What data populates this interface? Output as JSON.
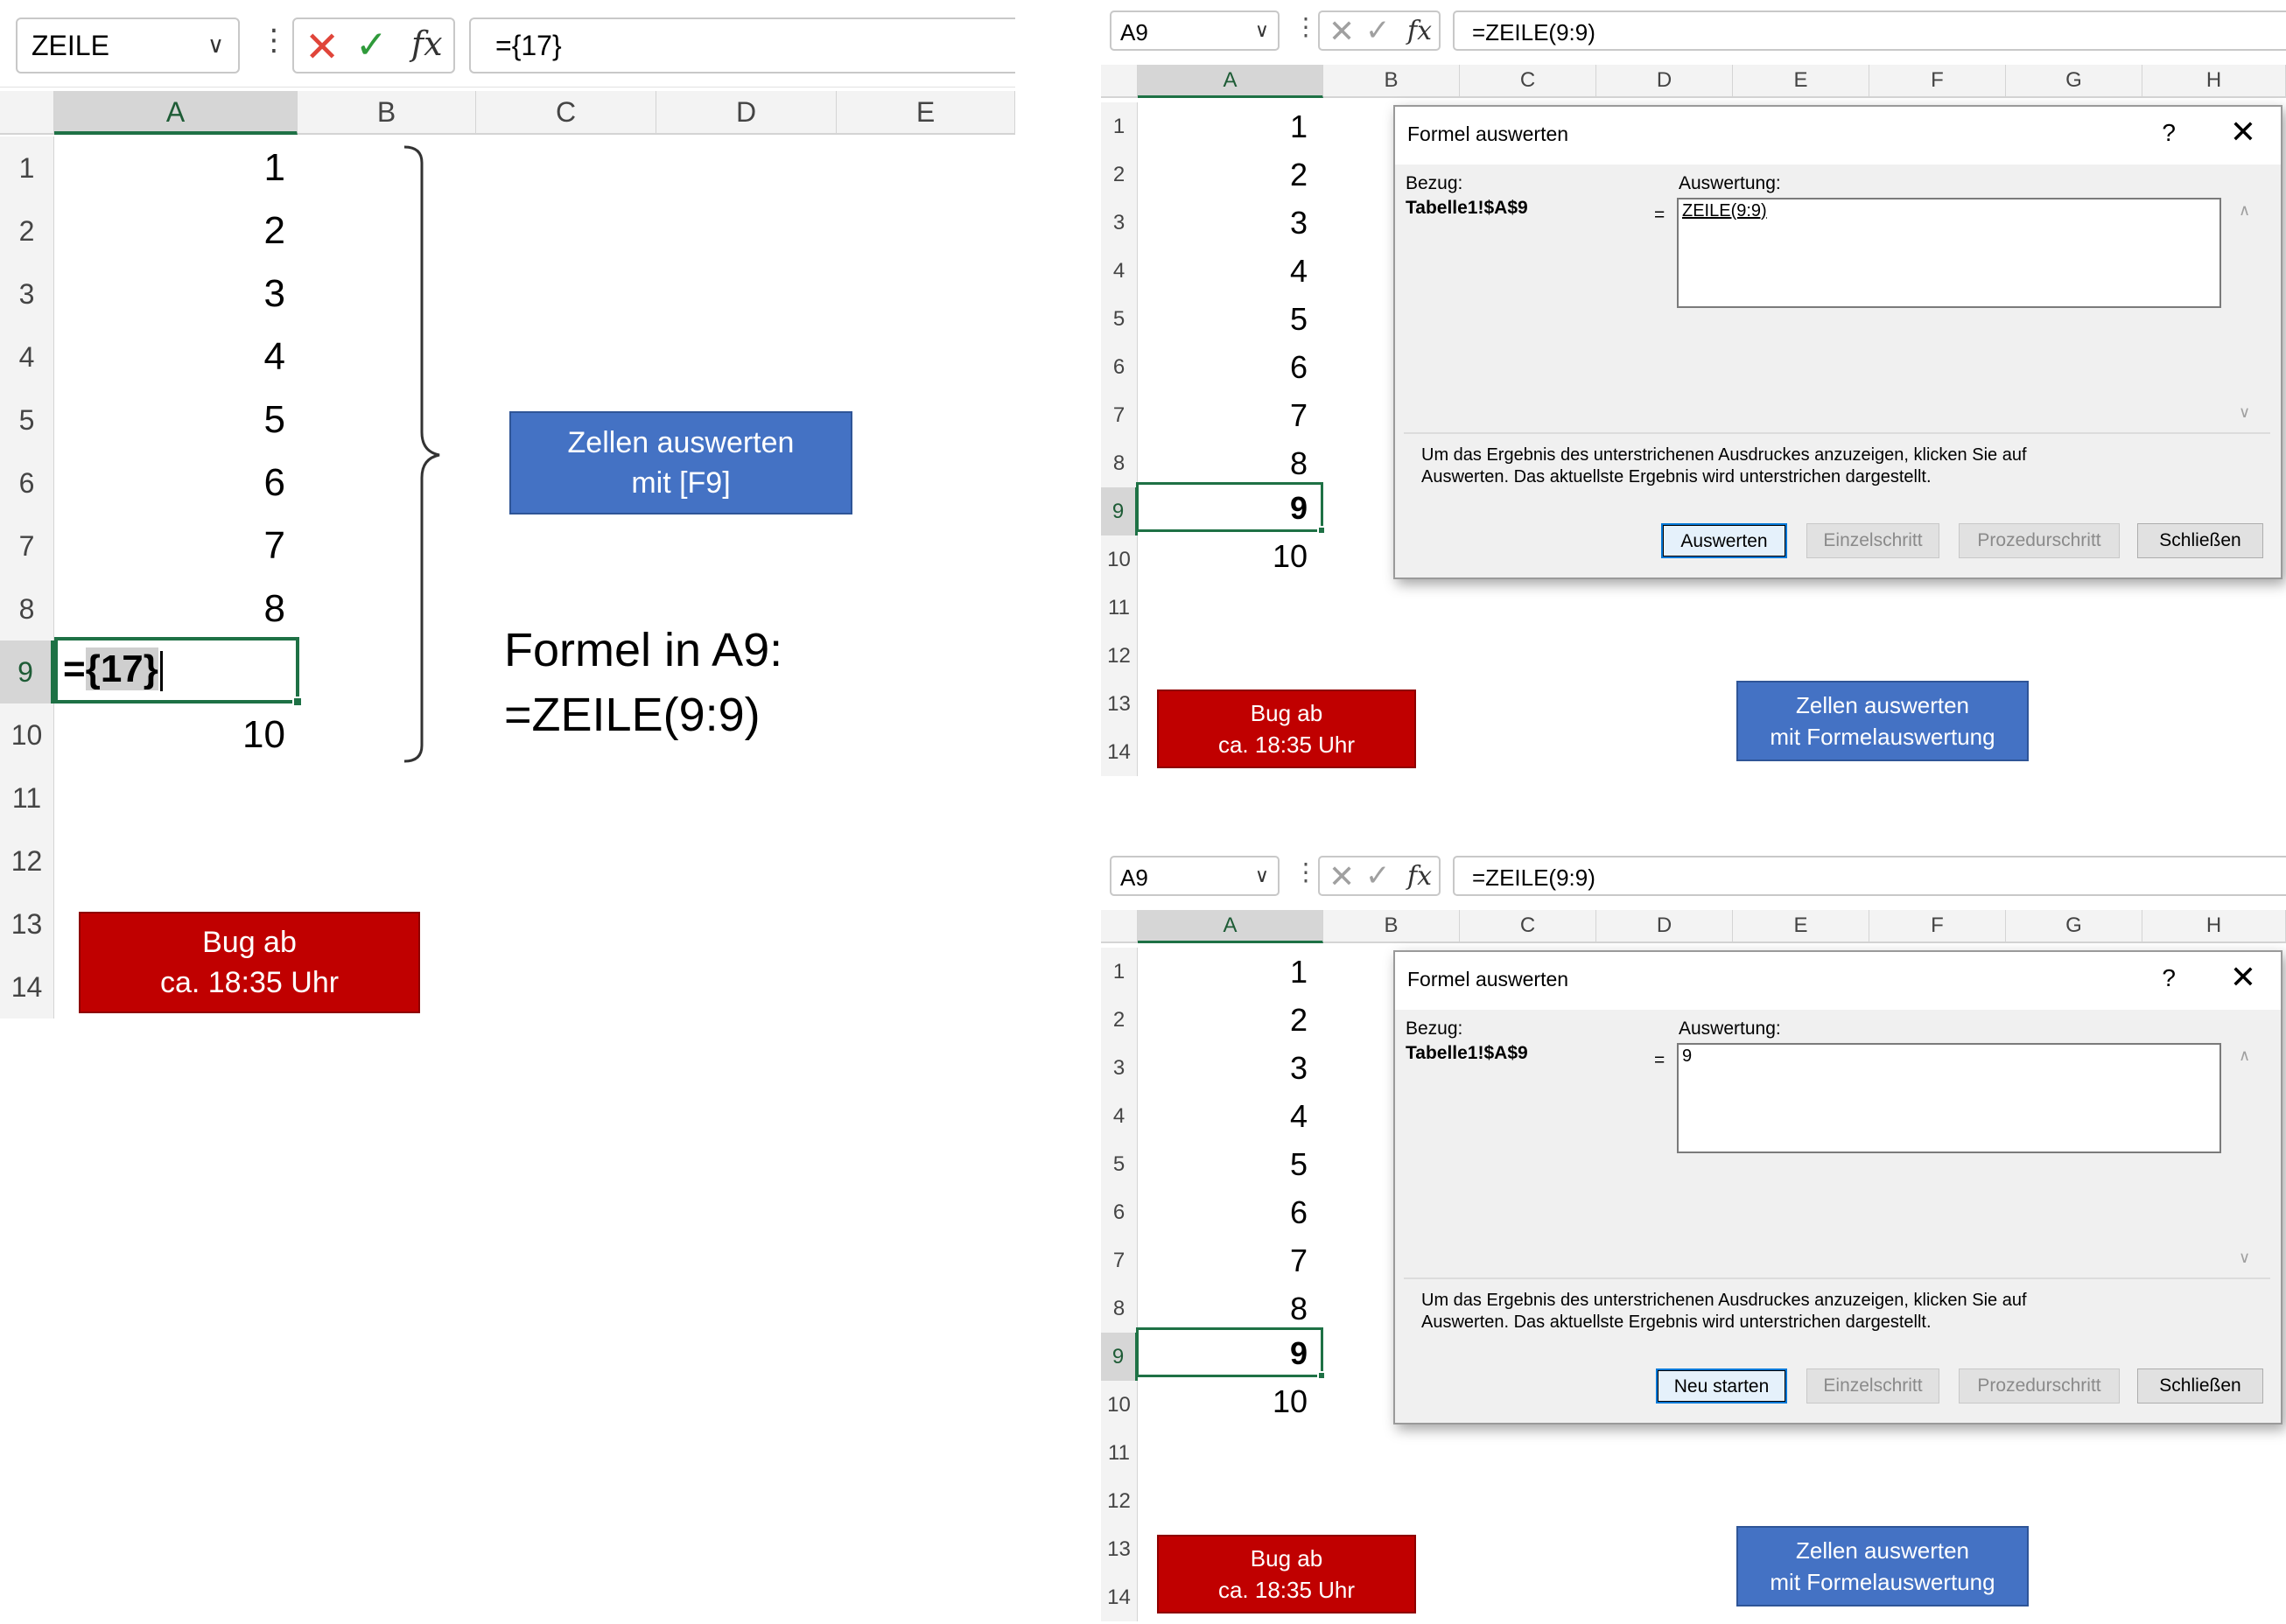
{
  "panel1": {
    "name_box": "ZEILE",
    "formula": "={17}",
    "columns": [
      "A",
      "B",
      "C",
      "D",
      "E"
    ],
    "rows": [
      "1",
      "2",
      "3",
      "4",
      "5",
      "6",
      "7",
      "8",
      "9",
      "10",
      "11",
      "12",
      "13",
      "14"
    ],
    "values": [
      "1",
      "2",
      "3",
      "4",
      "5",
      "6",
      "7",
      "8",
      "",
      "10"
    ],
    "edit_cell": {
      "prefix": "=",
      "highlight": "{17}"
    },
    "eval_button": [
      "Zellen auswerten",
      "mit [F9]"
    ],
    "bug_badge": [
      "Bug ab",
      "ca. 18:35 Uhr"
    ],
    "note": [
      "Formel in A9:",
      "=ZEILE(9:9)"
    ]
  },
  "panel2": {
    "name_box": "A9",
    "formula": "=ZEILE(9:9)",
    "columns": [
      "A",
      "B",
      "C",
      "D",
      "E",
      "F",
      "G",
      "H"
    ],
    "rows": [
      "1",
      "2",
      "3",
      "4",
      "5",
      "6",
      "7",
      "8",
      "9",
      "10",
      "11",
      "12",
      "13",
      "14"
    ],
    "values": [
      "1",
      "2",
      "3",
      "4",
      "5",
      "6",
      "7",
      "8",
      "9",
      "10"
    ],
    "dialog": {
      "title": "Formel auswerten",
      "help_icon": "?",
      "ref_label": "Bezug:",
      "ref_value": "Tabelle1!$A$9",
      "eq": "=",
      "eval_label": "Auswertung:",
      "eval_value": "ZEILE(9:9)",
      "help_text": [
        "Um das Ergebnis des unterstrichenen Ausdruckes anzuzeigen, klicken Sie auf",
        "Auswerten. Das aktuellste Ergebnis wird unterstrichen dargestellt."
      ],
      "buttons": [
        "Auswerten",
        "Einzelschritt",
        "Prozedurschritt",
        "Schließen"
      ]
    },
    "bug_badge": [
      "Bug ab",
      "ca. 18:35 Uhr"
    ],
    "eval_button": [
      "Zellen auswerten",
      "mit Formelauswertung"
    ]
  },
  "panel3": {
    "name_box": "A9",
    "formula": "=ZEILE(9:9)",
    "columns": [
      "A",
      "B",
      "C",
      "D",
      "E",
      "F",
      "G",
      "H"
    ],
    "rows": [
      "1",
      "2",
      "3",
      "4",
      "5",
      "6",
      "7",
      "8",
      "9",
      "10",
      "11",
      "12",
      "13",
      "14"
    ],
    "values": [
      "1",
      "2",
      "3",
      "4",
      "5",
      "6",
      "7",
      "8",
      "9",
      "10"
    ],
    "dialog": {
      "title": "Formel auswerten",
      "help_icon": "?",
      "ref_label": "Bezug:",
      "ref_value": "Tabelle1!$A$9",
      "eq": "=",
      "eval_label": "Auswertung:",
      "eval_value": "9",
      "help_text": [
        "Um das Ergebnis des unterstrichenen Ausdruckes anzuzeigen, klicken Sie auf",
        "Auswerten. Das aktuellste Ergebnis wird unterstrichen dargestellt."
      ],
      "buttons": [
        "Neu starten",
        "Einzelschritt",
        "Prozedurschritt",
        "Schließen"
      ]
    },
    "bug_badge": [
      "Bug ab",
      "ca. 18:35 Uhr"
    ],
    "eval_button": [
      "Zellen auswerten",
      "mit Formelauswertung"
    ]
  },
  "colors": {
    "excel_green": "#1e7145",
    "button_blue": "#4472c4",
    "badge_red": "#c00000",
    "cancel_red": "#e0453a",
    "enter_green": "#2f9a3a"
  }
}
